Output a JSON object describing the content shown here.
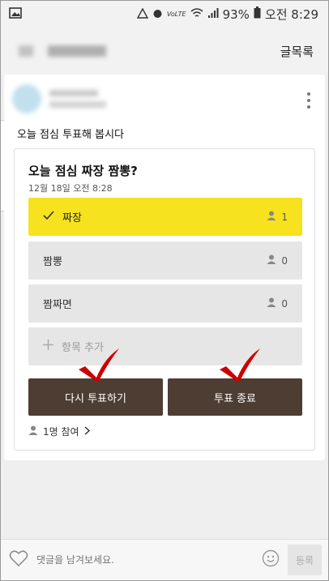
{
  "status_bar": {
    "battery": "93%",
    "time": "오전 8:29"
  },
  "header": {
    "right_label": "글목록"
  },
  "post": {
    "text": "오늘 점심 투표해 봅시다"
  },
  "vote": {
    "title": "오늘 점심 짜장 짬뽕?",
    "date": "12월 18일 오전 8:28",
    "options": [
      {
        "label": "짜장",
        "count": "1",
        "selected": true
      },
      {
        "label": "짬뽕",
        "count": "0",
        "selected": false
      },
      {
        "label": "짬짜면",
        "count": "0",
        "selected": false
      }
    ],
    "add_label": "항목 추가",
    "revote_label": "다시 투표하기",
    "end_label": "투표 종료",
    "participants": "1명 참여"
  },
  "footer": {
    "comment_placeholder": "댓글을 남겨보세요.",
    "submit_label": "등록"
  },
  "colors": {
    "selected": "#f7e21f",
    "button": "#4d3d33",
    "check": "#cc0000"
  }
}
